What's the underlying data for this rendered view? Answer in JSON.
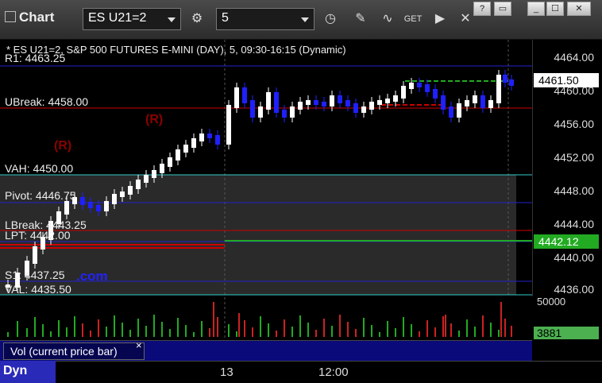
{
  "toolbar": {
    "title": "Chart",
    "symbol": "ES U21=2",
    "interval": "5",
    "window_buttons": [
      "?",
      "▭",
      "_",
      "☐",
      "✕"
    ]
  },
  "chart": {
    "header": "* ES U21=2, S&P 500 FUTURES E-MINI (DAY), 5, 09:30-16:15 (Dynamic)",
    "y_ticks": [
      "4464.00",
      "4460.00",
      "4456.00",
      "4452.00",
      "4448.00",
      "4444.00",
      "4440.00",
      "4436.00"
    ],
    "last_price": "4461.50",
    "green_price": "4442.12",
    "levels": [
      {
        "label": "R1: 4463.25"
      },
      {
        "label": "UBreak: 4458.00"
      },
      {
        "label": "VAH: 4450.00"
      },
      {
        "label": "Pivot: 4446.75"
      },
      {
        "label": "LBreak: 4443.25"
      },
      {
        "label": "LPT: 4442.00"
      },
      {
        "label": "S1: 4437.25"
      },
      {
        "label": "VAL: 4435.50"
      }
    ],
    "r_markers": [
      "(R)",
      "(R)"
    ],
    "watermark": ".com"
  },
  "volume": {
    "scale_top": "50000",
    "current": "3881",
    "legend": "Vol (current price bar)"
  },
  "time_axis": {
    "labels": [
      "13",
      "12:00"
    ]
  },
  "footer": {
    "label": "Dyn"
  },
  "colors": {
    "up_bar": "#ffffff",
    "down_bar": "#2020ff",
    "level_red": "#cc0000",
    "level_blue": "#2222cc",
    "level_cyan": "#33cccc",
    "green": "#22aa22",
    "price_box": "#ffffff"
  }
}
